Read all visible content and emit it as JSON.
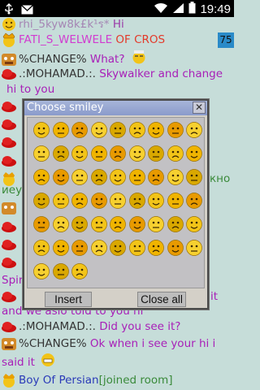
{
  "status_bar": {
    "time": "19:49"
  },
  "chat": {
    "messages": [
      {
        "nick": "rhi_5kyw8k£k¹ร*",
        "text": " Hi",
        "nick_color": "#9a6aa8",
        "text_color": "#9a3aa8"
      },
      {
        "nick": "FATI_S_WELWELE",
        "text": " OF CROS",
        "nick_color": "#d13bd0",
        "text_color": "#e33a2a",
        "badge": "75"
      },
      {
        "nick": "%CHANGE%",
        "text": " What?",
        "nick_color": "#333333",
        "text_color": "#a81fb8"
      },
      {
        "nick": ".:MOHAMAD.:.",
        "text": "  Skywalker  and change",
        "nick_color": "#333333",
        "text_color": "#a81fb8"
      },
      {
        "nick": "",
        "text": " hi to you",
        "nick_color": "#333333",
        "text_color": "#a81fb8"
      },
      {
        "nick": "Spir",
        "text": "",
        "nick_color": "#a81fb8",
        "text_color": "#a81fb8"
      },
      {
        "nick": "",
        "text": "it",
        "nick_color": "#333333",
        "text_color": "#a81fb8"
      },
      {
        "nick": "",
        "text": " and we aslo told to you  hi",
        "nick_color": "#333333",
        "text_color": "#a81fb8"
      },
      {
        "nick": ".:MOHAMAD.:.",
        "text": "  Did you see it?",
        "nick_color": "#333333",
        "text_color": "#a81fb8"
      },
      {
        "nick": "%CHANGE%",
        "text": "  Ok when i see your hi i",
        "nick_color": "#333333",
        "text_color": "#a81fb8"
      },
      {
        "nick": "",
        "text": "said it",
        "nick_color": "#333333",
        "text_color": "#a81fb8"
      },
      {
        "nick": "Boy Of Persian",
        "text": "[joined room]",
        "nick_color": "#2a3ab8",
        "text_color": "#3a8a3a"
      }
    ],
    "side_fragments": [
      "кно",
      "иеуе"
    ]
  },
  "dialog": {
    "title": "Choose smiley",
    "insert_label": "Insert",
    "close_all_label": "Close all",
    "smileys": [
      "smiley-1",
      "smiley-2",
      "smiley-3",
      "smiley-4",
      "smiley-5",
      "smiley-6",
      "smiley-7",
      "smiley-8",
      "smiley-9",
      "smiley-10",
      "smiley-11",
      "smiley-12",
      "smiley-13",
      "smiley-14",
      "smiley-15",
      "smiley-16",
      "smiley-17",
      "smiley-18",
      "smiley-19",
      "smiley-20",
      "smiley-21",
      "smiley-22",
      "smiley-23",
      "smiley-24",
      "smiley-25",
      "smiley-26",
      "smiley-27",
      "smiley-28",
      "smiley-29",
      "smiley-30",
      "smiley-31",
      "smiley-32",
      "smiley-33",
      "smiley-34",
      "smiley-35",
      "smiley-36",
      "smiley-37",
      "smiley-38",
      "smiley-39",
      "smiley-40",
      "smiley-41",
      "smiley-42",
      "smiley-43",
      "smiley-44",
      "smiley-45",
      "smiley-46",
      "smiley-47",
      "smiley-48",
      "smiley-49",
      "smiley-50",
      "smiley-51",
      "smiley-52",
      "smiley-53",
      "smiley-54",
      "smiley-55",
      "smiley-56",
      "smiley-57"
    ]
  }
}
